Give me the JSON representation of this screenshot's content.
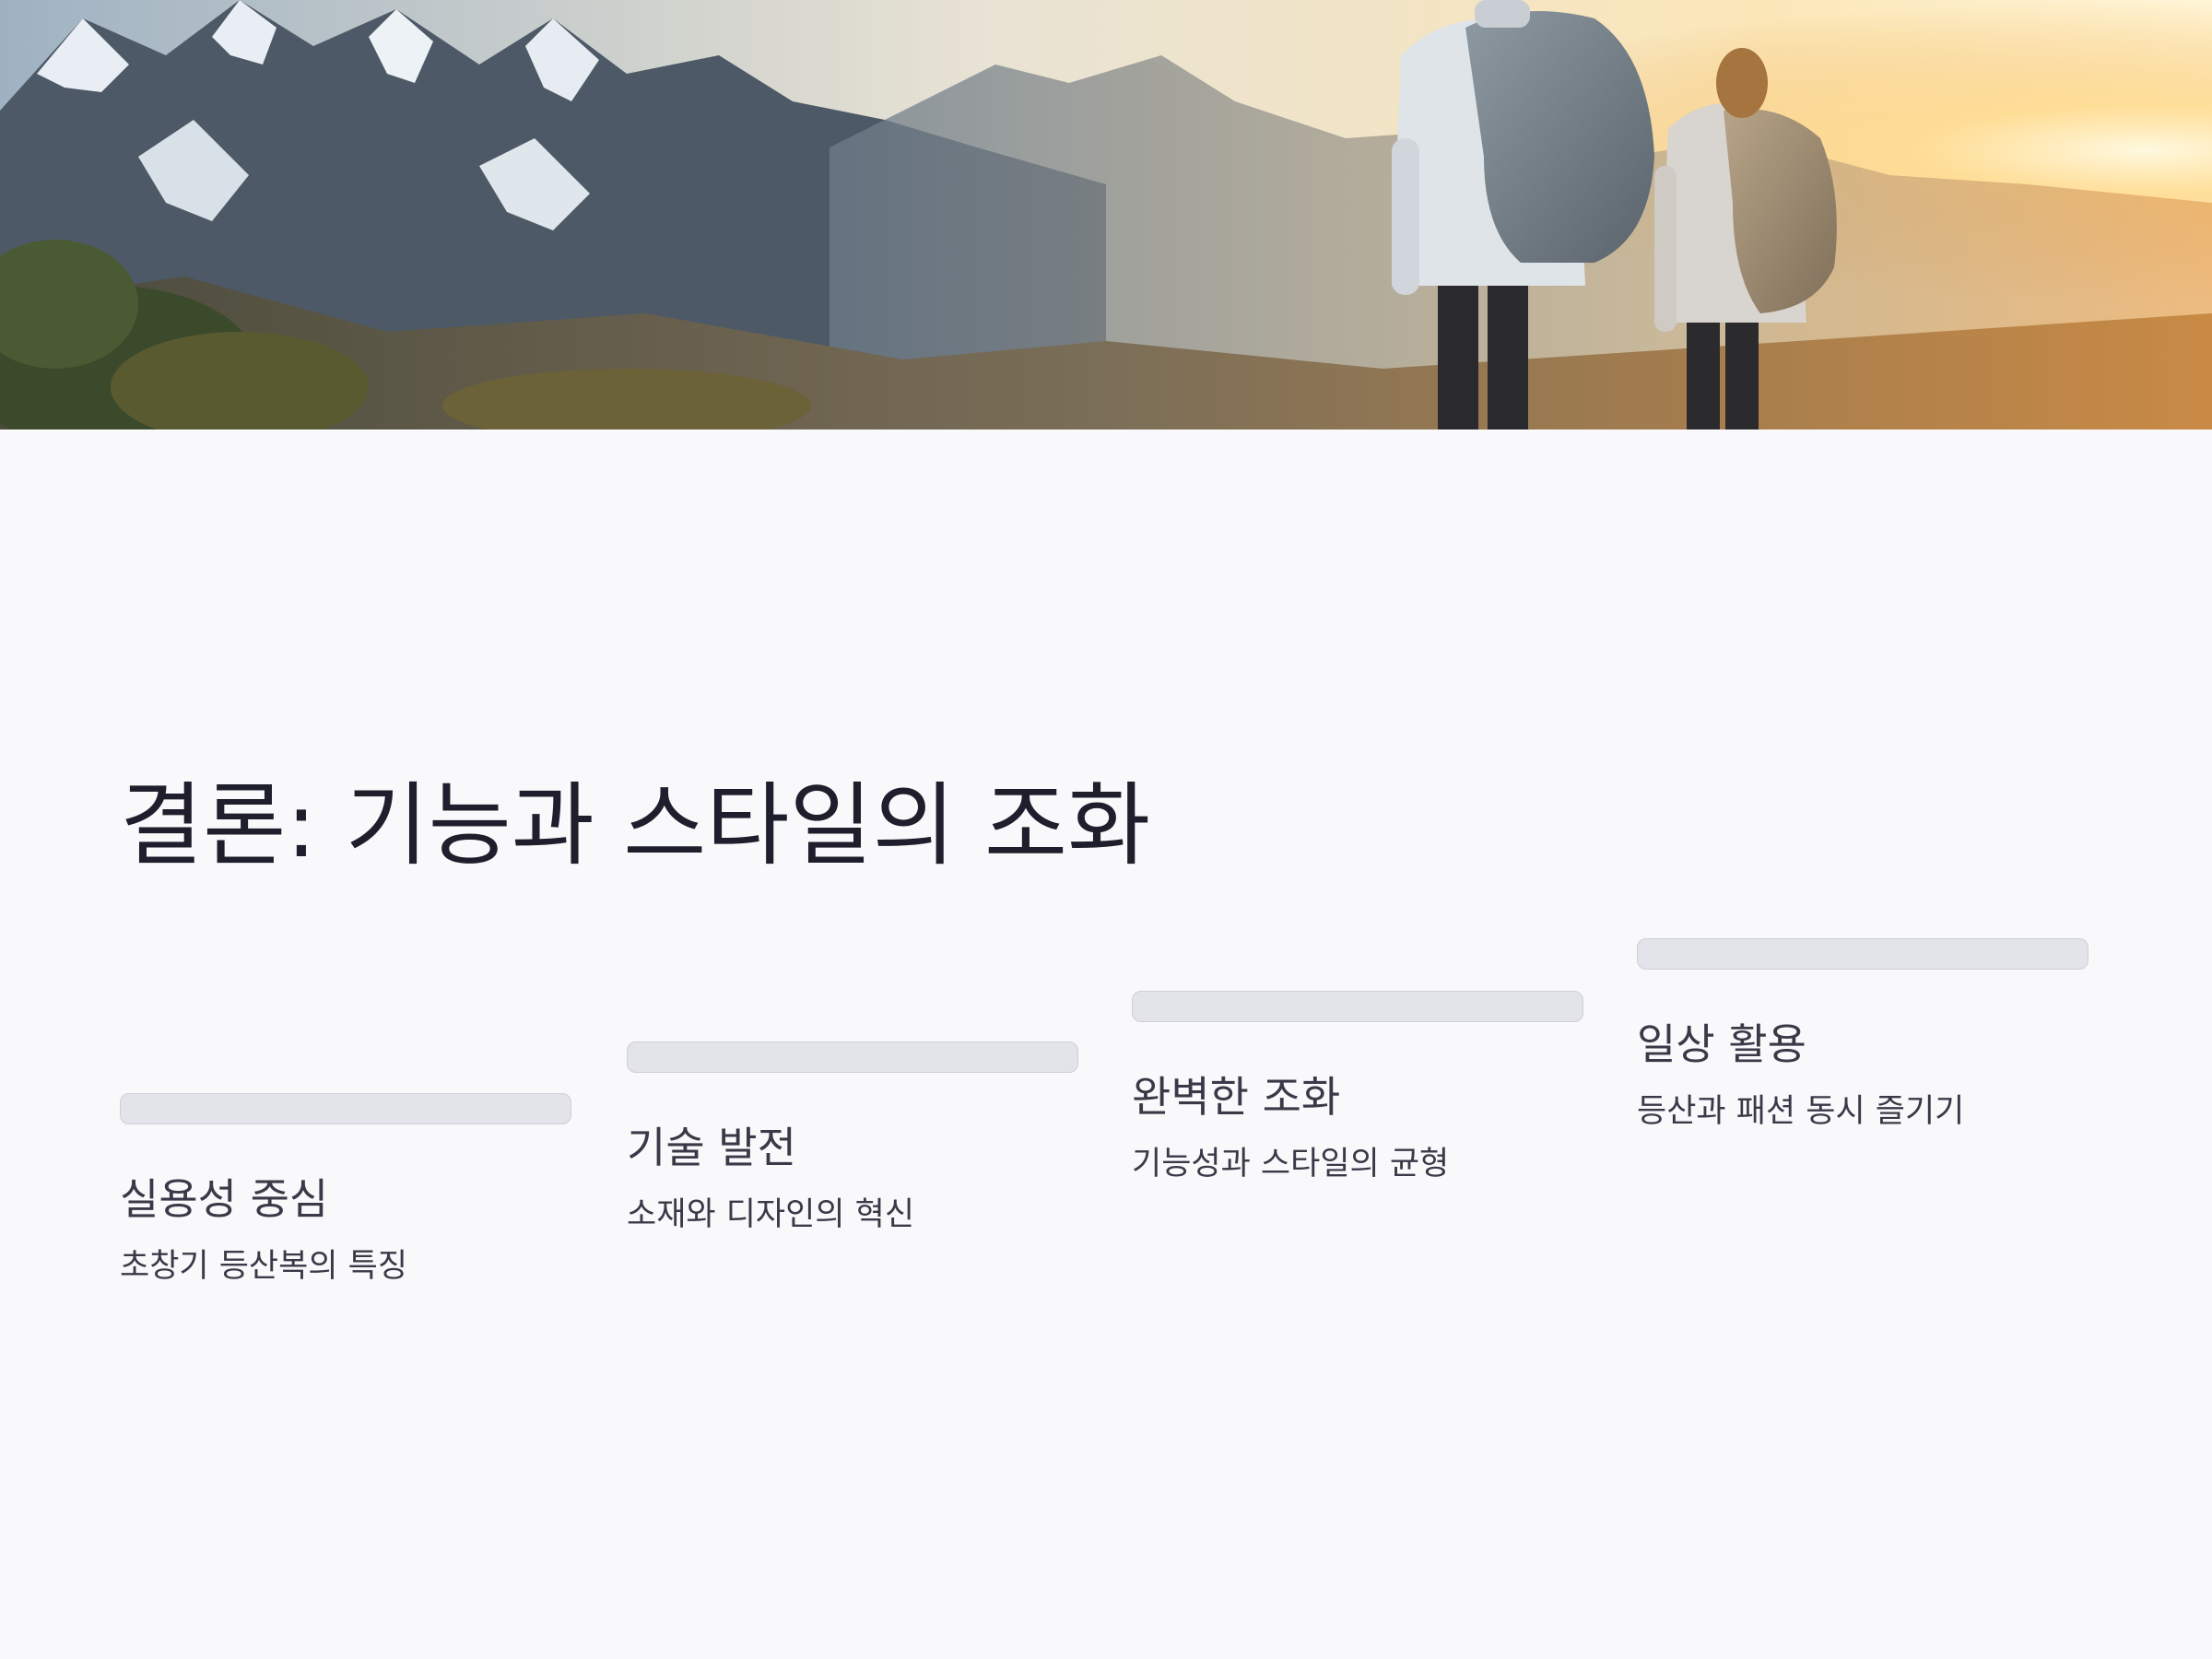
{
  "slide": {
    "title": "결론: 기능과 스타일의 조화"
  },
  "hero_image": {
    "subject": "two hikers with backpacks facing snowy mountains at sunset"
  },
  "steps": [
    {
      "label": "실용성 중심",
      "desc": "초창기 등산복의 특징"
    },
    {
      "label": "기술 발전",
      "desc": "소재와 디자인의 혁신"
    },
    {
      "label": "완벽한 조화",
      "desc": "기능성과 스타일의 균형"
    },
    {
      "label": "일상 활용",
      "desc": "등산과 패션 동시 즐기기"
    }
  ],
  "colors": {
    "background": "#f9f9fb",
    "title_text": "#1f1e2c",
    "body_text": "#3a3948",
    "bar_fill": "#e3e3ea",
    "bar_border": "#cfcfd8"
  }
}
